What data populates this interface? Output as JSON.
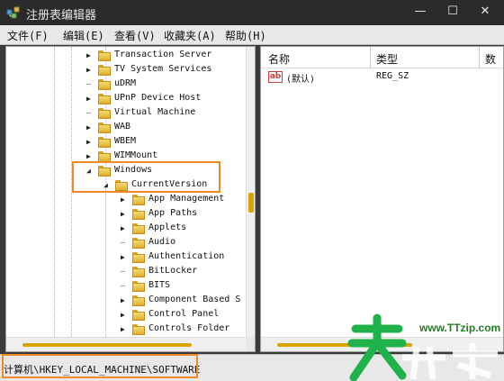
{
  "window": {
    "title": "注册表编辑器",
    "controls": {
      "minimize": "—",
      "maximize": "☐",
      "close": "✕"
    }
  },
  "menu": [
    {
      "label": "文件(F)"
    },
    {
      "label": "编辑(E)"
    },
    {
      "label": "查看(V)"
    },
    {
      "label": "收藏夹(A)"
    },
    {
      "label": "帮助(H)"
    }
  ],
  "tree": {
    "items": [
      {
        "label": "Transaction Server",
        "expander": "collapsed"
      },
      {
        "label": "TV System Services",
        "expander": "collapsed"
      },
      {
        "label": "uDRM",
        "expander": "none"
      },
      {
        "label": "UPnP Device Host",
        "expander": "collapsed"
      },
      {
        "label": "Virtual Machine",
        "expander": "none"
      },
      {
        "label": "WAB",
        "expander": "collapsed"
      },
      {
        "label": "WBEM",
        "expander": "collapsed"
      },
      {
        "label": "WIMMount",
        "expander": "collapsed"
      },
      {
        "label": "Windows",
        "expander": "expanded"
      },
      {
        "label": "CurrentVersion",
        "expander": "expanded"
      },
      {
        "label": "App Management",
        "expander": "collapsed"
      },
      {
        "label": "App Paths",
        "expander": "collapsed"
      },
      {
        "label": "Applets",
        "expander": "collapsed"
      },
      {
        "label": "Audio",
        "expander": "none"
      },
      {
        "label": "Authentication",
        "expander": "collapsed"
      },
      {
        "label": "BitLocker",
        "expander": "none"
      },
      {
        "label": "BITS",
        "expander": "none"
      },
      {
        "label": "Component Based S",
        "expander": "collapsed"
      },
      {
        "label": "Control Panel",
        "expander": "collapsed"
      },
      {
        "label": "Controls Folder",
        "expander": "collapsed"
      }
    ]
  },
  "list": {
    "columns": [
      "名称",
      "类型",
      "数"
    ],
    "rows": [
      {
        "icon": "ab",
        "name": "(默认)",
        "type": "REG_SZ"
      }
    ]
  },
  "status": {
    "path": "计算机\\HKEY_LOCAL_MACHINE\\SOFTWARE"
  },
  "watermark": {
    "url": "www.TTzip.com"
  },
  "colors": {
    "accent_scroll": "#d8a400",
    "highlight": "#f08a24",
    "titlebar": "#2b2b2b"
  }
}
